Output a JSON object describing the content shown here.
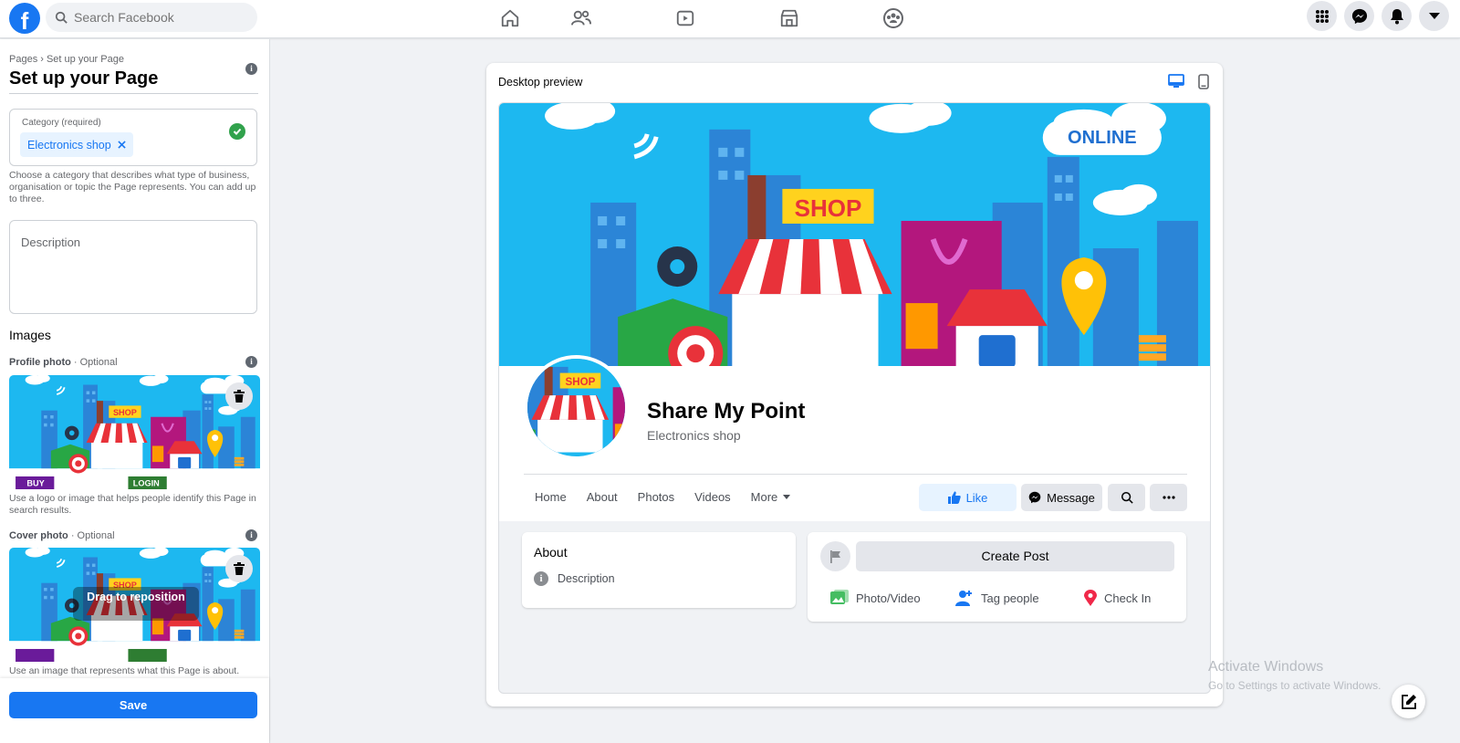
{
  "topbar": {
    "logo_letter": "f",
    "search_placeholder": "Search Facebook",
    "nav_icons": [
      "home-icon",
      "friends-icon",
      "watch-icon",
      "marketplace-icon",
      "groups-icon"
    ],
    "right_icons": [
      "menu-grid-icon",
      "messenger-icon",
      "notifications-icon",
      "account-dropdown-icon"
    ]
  },
  "sidebar": {
    "breadcrumb": "Pages › Set up your Page",
    "title": "Set up your Page",
    "category_label": "Category (required)",
    "category_chip": "Electronics shop",
    "category_help": "Choose a category that describes what type of business, organisation or topic the Page represents. You can add up to three.",
    "description_placeholder": "Description",
    "images_heading": "Images",
    "profile_label": "Profile photo",
    "profile_optional": " · Optional",
    "profile_help": "Use a logo or image that helps people identify this Page in search results.",
    "cover_label": "Cover photo",
    "cover_optional": " · Optional",
    "cover_drag_text": "Drag to reposition",
    "cover_help": "Use an image that represents what this Page is about.",
    "save_label": "Save"
  },
  "preview": {
    "title": "Desktop preview",
    "cover_shop_text": "SHOP",
    "cover_online_text": "ONLINE",
    "cover_buy_text": "BUY",
    "cover_login_text": "LOGIN",
    "page_name": "Share My Point",
    "page_category": "Electronics shop",
    "tabs": [
      "Home",
      "About",
      "Photos",
      "Videos",
      "More"
    ],
    "like_label": "Like",
    "message_label": "Message",
    "about_heading": "About",
    "about_description": "Description",
    "create_post_label": "Create Post",
    "actions": [
      "Photo/Video",
      "Tag people",
      "Check In"
    ]
  },
  "watermark": {
    "line1": "Activate Windows",
    "line2": "Go to Settings to activate Windows."
  },
  "colors": {
    "brand": "#1877f2",
    "success": "#31a24c",
    "cover_sky": "#1db8f0"
  }
}
